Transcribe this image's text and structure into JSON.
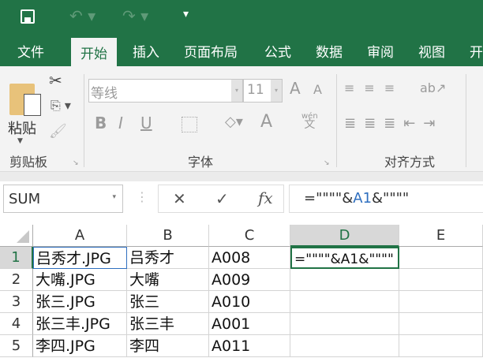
{
  "qat": {
    "save": "save-icon",
    "undo": "undo-icon",
    "redo": "redo-icon",
    "customize": "▾"
  },
  "tabs": [
    "文件",
    "开始",
    "插入",
    "页面布局",
    "公式",
    "数据",
    "审阅",
    "视图",
    "开"
  ],
  "ribbon": {
    "clipboard": {
      "paste": "粘贴",
      "label": "剪贴板"
    },
    "font": {
      "name": "等线",
      "size": "11",
      "label": "字体",
      "bold": "B",
      "italic": "I",
      "underline": "U",
      "grow": "A",
      "shrink": "A",
      "color": "A",
      "phonetic_top": "wén",
      "phonetic_bottom": "文"
    },
    "alignment": {
      "label": "对齐方式"
    }
  },
  "formula_bar": {
    "name_box": "SUM",
    "cancel": "✕",
    "enter": "✓",
    "fx": "fx",
    "formula_pre": "=\"\"\"\"&",
    "formula_ref": "A1",
    "formula_post": "&\"\"\"\""
  },
  "columns": [
    "A",
    "B",
    "C",
    "D",
    "E"
  ],
  "rows": [
    {
      "n": "1",
      "a": "吕秀才.JPG",
      "b": "吕秀才",
      "c": "A008",
      "d": "=\"\"\"\"&A1&\"\"\"\""
    },
    {
      "n": "2",
      "a": "大嘴.JPG",
      "b": "大嘴",
      "c": "A009",
      "d": ""
    },
    {
      "n": "3",
      "a": "张三.JPG",
      "b": "张三",
      "c": "A010",
      "d": ""
    },
    {
      "n": "4",
      "a": "张三丰.JPG",
      "b": "张三丰",
      "c": "A001",
      "d": ""
    },
    {
      "n": "5",
      "a": "李四.JPG",
      "b": "李四",
      "c": "A011",
      "d": ""
    }
  ],
  "colors": {
    "brand": "#217346",
    "ref": "#2f6fbf"
  }
}
